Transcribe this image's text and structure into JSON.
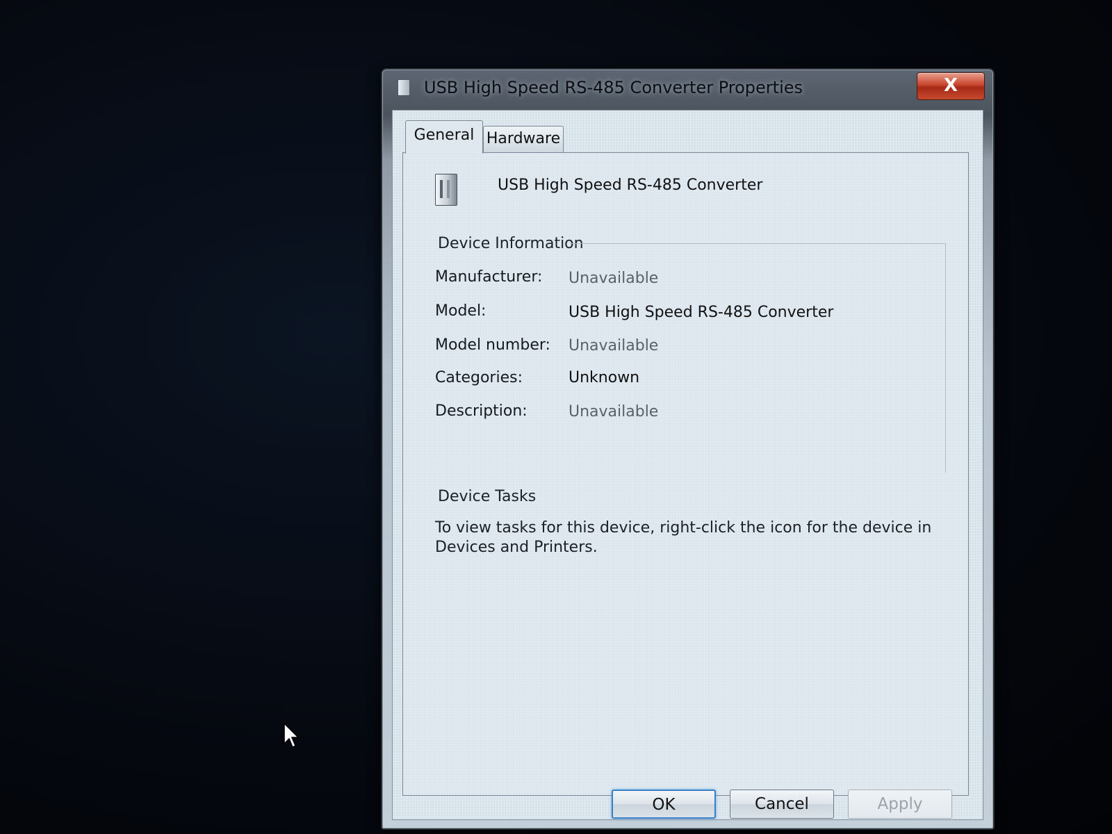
{
  "window": {
    "title": "USB High Speed RS-485 Converter Properties",
    "close_label": "X"
  },
  "tabs": [
    {
      "label": "General",
      "selected": true
    },
    {
      "label": "Hardware",
      "selected": false
    }
  ],
  "device": {
    "name": "USB High Speed RS-485 Converter",
    "icon": "usb-device-icon"
  },
  "device_information": {
    "heading": "Device Information",
    "rows": [
      {
        "label": "Manufacturer:",
        "value": "Unavailable"
      },
      {
        "label": "Model:",
        "value": "USB High Speed RS-485 Converter"
      },
      {
        "label": "Model number:",
        "value": "Unavailable"
      },
      {
        "label": "Categories:",
        "value": "Unknown"
      },
      {
        "label": "Description:",
        "value": "Unavailable"
      }
    ]
  },
  "device_tasks": {
    "heading": "Device Tasks",
    "text": "To view tasks for this device, right-click the icon for the device in Devices and Printers."
  },
  "buttons": {
    "ok": "OK",
    "cancel": "Cancel",
    "apply": "Apply"
  },
  "colors": {
    "ok_focus": "#3a7fc4",
    "close_red": "#c8452e"
  }
}
